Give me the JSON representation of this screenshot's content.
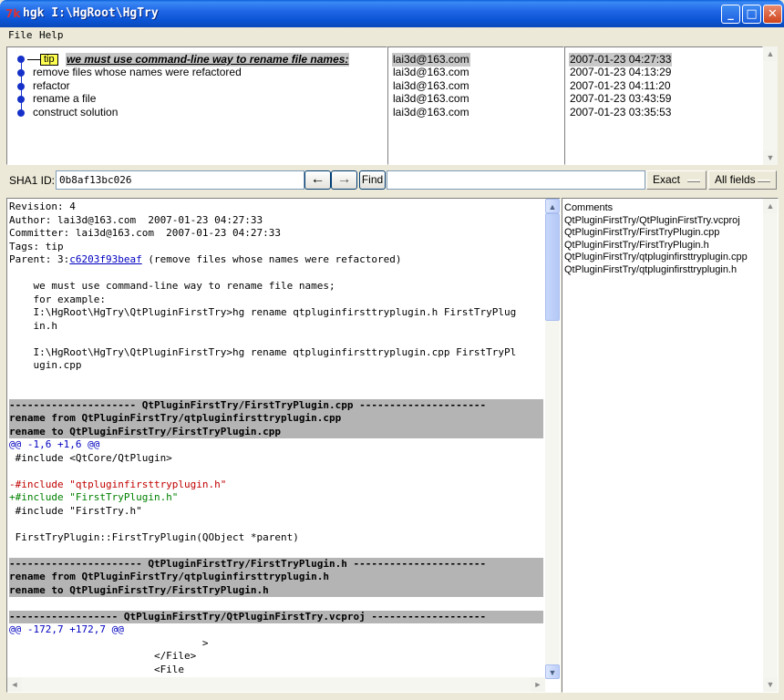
{
  "window": {
    "title": "hgk I:\\HgRoot\\HgTry",
    "minimize": "_",
    "maximize": "□",
    "close": "✕"
  },
  "menu": {
    "file": "File",
    "help": "Help"
  },
  "commits": {
    "tip_tag": "tip",
    "items": [
      {
        "summary": "we must use command-line way to rename file names:",
        "author": "lai3d@163.com",
        "date": "2007-01-23 04:27:33"
      },
      {
        "summary": "remove files whose names were refactored",
        "author": "lai3d@163.com",
        "date": "2007-01-23 04:13:29"
      },
      {
        "summary": "refactor",
        "author": "lai3d@163.com",
        "date": "2007-01-23 04:11:20"
      },
      {
        "summary": "rename a file",
        "author": "lai3d@163.com",
        "date": "2007-01-23 03:43:59"
      },
      {
        "summary": "construct solution",
        "author": "lai3d@163.com",
        "date": "2007-01-23 03:35:53"
      }
    ]
  },
  "search": {
    "sha_label": "SHA1 ID:",
    "sha_value": "0b8af13bc026",
    "back": "←",
    "forward": "→",
    "find_label": "Find",
    "find_value": "",
    "mode": "Exact",
    "fields": "All fields"
  },
  "diff": {
    "l01": "Revision: 4",
    "l02": "Author: lai3d@163.com  2007-01-23 04:27:33",
    "l03": "Committer: lai3d@163.com  2007-01-23 04:27:33",
    "l04": "Tags: tip",
    "l05_prefix": "Parent: 3:",
    "l05_link": "c6203f93beaf",
    "l05_suffix": " (remove files whose names were refactored)",
    "l06": "",
    "l07": "    we must use command-line way to rename file names;",
    "l08": "    for example:",
    "l09": "    I:\\HgRoot\\HgTry\\QtPluginFirstTry>hg rename qtpluginfirsttryplugin.h FirstTryPlug",
    "l10": "    in.h",
    "l11": "",
    "l12": "    I:\\HgRoot\\HgTry\\QtPluginFirstTry>hg rename qtpluginfirsttryplugin.cpp FirstTryPl",
    "l13": "    ugin.cpp",
    "l14": "",
    "l15": "",
    "h1a": "--------------------- QtPluginFirstTry/FirstTryPlugin.cpp ---------------------",
    "h1b": "rename from QtPluginFirstTry/qtpluginfirsttryplugin.cpp",
    "h1c": "rename to QtPluginFirstTry/FirstTryPlugin.cpp",
    "k1": "@@ -1,6 +1,6 @@",
    "c01": " #include <QtCore/QtPlugin>",
    "c02": "",
    "c03": "-#include \"qtpluginfirsttryplugin.h\"",
    "c04": "+#include \"FirstTryPlugin.h\"",
    "c05": " #include \"FirstTry.h\"",
    "c06": "",
    "c07": " FirstTryPlugin::FirstTryPlugin(QObject *parent)",
    "c08": "",
    "h2a": "---------------------- QtPluginFirstTry/FirstTryPlugin.h ----------------------",
    "h2b": "rename from QtPluginFirstTry/qtpluginfirsttryplugin.h",
    "h2c": "rename to QtPluginFirstTry/FirstTryPlugin.h",
    "c09": "",
    "h3a": "------------------ QtPluginFirstTry/QtPluginFirstTry.vcproj -------------------",
    "k2": "@@ -172,7 +172,7 @@",
    "c10": "                                >",
    "c11": "                        </File>",
    "c12": "                        <File"
  },
  "files": {
    "header": "Comments",
    "items": [
      "QtPluginFirstTry/QtPluginFirstTry.vcproj",
      "QtPluginFirstTry/FirstTryPlugin.cpp",
      "QtPluginFirstTry/FirstTryPlugin.h",
      "QtPluginFirstTry/qtpluginfirsttryplugin.cpp",
      "QtPluginFirstTry/qtpluginfirsttryplugin.h"
    ]
  }
}
